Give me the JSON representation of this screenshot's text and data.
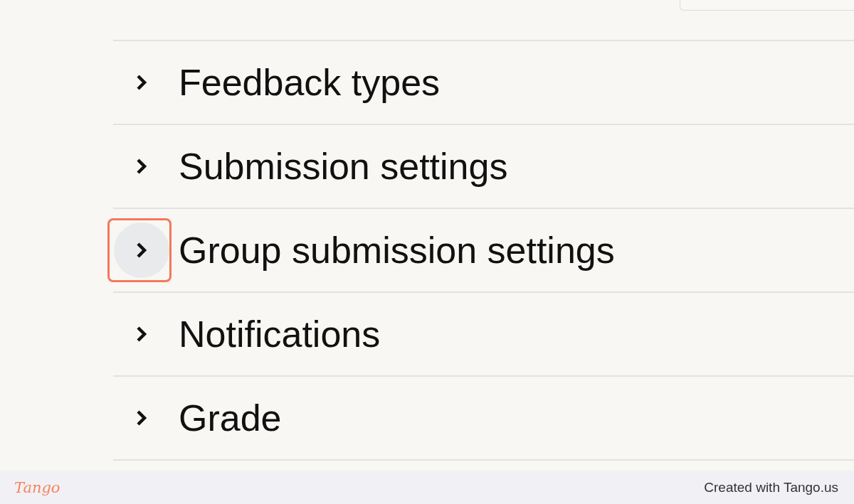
{
  "sections": [
    {
      "label": "Feedback types",
      "expanded": false,
      "highlighted": false
    },
    {
      "label": "Submission settings",
      "expanded": false,
      "highlighted": false
    },
    {
      "label": "Group submission settings",
      "expanded": false,
      "highlighted": true
    },
    {
      "label": "Notifications",
      "expanded": false,
      "highlighted": false
    },
    {
      "label": "Grade",
      "expanded": false,
      "highlighted": false
    }
  ],
  "footer": {
    "logo": "Tango",
    "credit": "Created with Tango.us"
  }
}
